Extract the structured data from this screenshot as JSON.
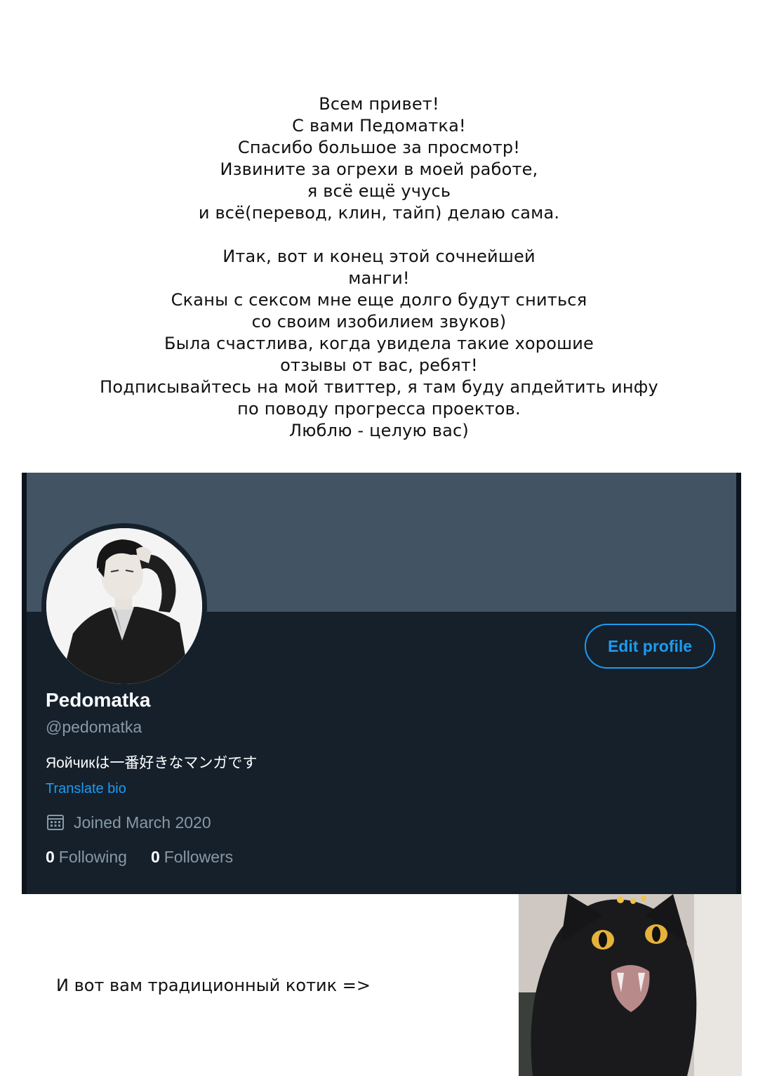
{
  "message": {
    "paragraph1": [
      "Всем привет!",
      "С вами Педоматка!",
      "Спасибо большое за просмотр!",
      "Извините за огрехи в моей работе,",
      "я всё ещё учусь",
      "и всё(перевод, клин, тайп) делаю сама."
    ],
    "paragraph2": [
      "Итак, вот и конец этой сочнейшей",
      "манги!",
      "Сканы с сексом мне еще долго будут сниться",
      "со своим изобилием звуков)",
      "Была счастлива, когда увидела такие хорошие",
      "отзывы от вас, ребят!",
      "Подписывайтесь на мой твиттер, я там буду апдейтить инфу",
      "по поводу прогресса проектов.",
      "Люблю - целую вас)"
    ]
  },
  "profile": {
    "name": "Pedomatka",
    "handle": "@pedomatka",
    "bio": "Яойчикは一番好きなマンガです",
    "translate_label": "Translate bio",
    "joined": "Joined March 2020",
    "edit_label": "Edit profile",
    "following_count": "0",
    "following_label": "Following",
    "followers_count": "0",
    "followers_label": "Followers",
    "colors": {
      "accent": "#1d9bf0",
      "background": "#15202b",
      "banner": "#425363",
      "secondary_text": "#8899a6"
    },
    "icons": {
      "joined": "calendar-icon"
    }
  },
  "footer": {
    "cat_caption": "И вот вам традиционный котик =>"
  }
}
